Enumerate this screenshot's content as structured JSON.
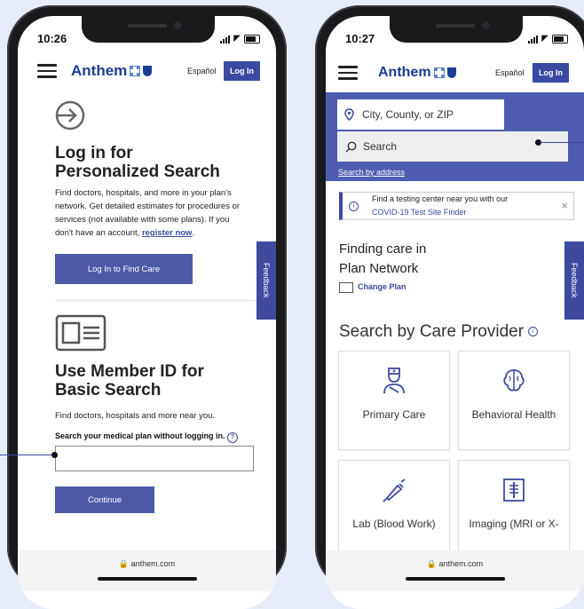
{
  "left_phone": {
    "time": "10:26",
    "header": {
      "logo": "Anthem",
      "lang": "Español",
      "login": "Log In"
    },
    "section1": {
      "title_line1": "Log in for",
      "title_line2": "Personalized Search",
      "body_line1": "Find doctors, hospitals, and more in your plan's",
      "body_line2": "network. Get detailed estimates for procedures or",
      "body_line3": "services (not available with some plans). If you",
      "body_line4_prefix": "don't have an account,",
      "body_link": "register now",
      "body_line4_suffix": ".",
      "button": "Log In to Find Care"
    },
    "section2": {
      "title_line1": "Use Member ID for",
      "title_line2": "Basic Search",
      "body": "Find doctors, hospitals and more near you.",
      "input_label": "Search your medical plan without logging in.",
      "button": "Continue"
    },
    "feedback": "Feedback",
    "url": "anthem.com"
  },
  "right_phone": {
    "time": "10:27",
    "header": {
      "logo": "Anthem",
      "lang": "Español",
      "login": "Log In"
    },
    "location_placeholder": "City, County, or ZIP",
    "search_placeholder": "Search",
    "search_by_address": "Search by address",
    "banner": {
      "line1": "Find a testing center near you with our",
      "line2": "COVID-19 Test Site Finder"
    },
    "finding_line1": "Finding care in",
    "finding_line2": "Plan Network",
    "change_plan": "Change Plan",
    "section_title": "Search by Care Provider",
    "cards": [
      "Primary Care",
      "Behavioral Health",
      "Lab (Blood Work)",
      "Imaging (MRI or X-"
    ],
    "feedback": "Feedback",
    "url": "anthem.com"
  },
  "colors": {
    "brand": "#1a3e95",
    "accent": "#4e5db0",
    "background": "#e6edf9"
  }
}
